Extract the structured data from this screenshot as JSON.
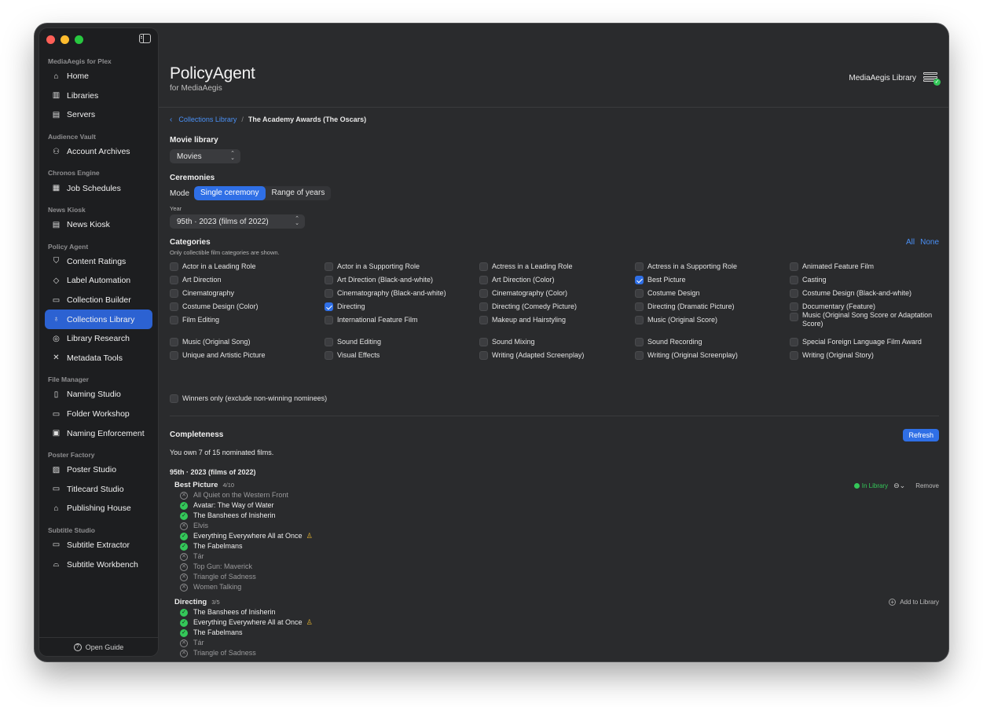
{
  "sidebar": {
    "sections": [
      {
        "title": "MediaAegis for Plex",
        "items": [
          {
            "label": "Home",
            "icon": "house-icon"
          },
          {
            "label": "Libraries",
            "icon": "books-icon"
          },
          {
            "label": "Servers",
            "icon": "server-icon"
          }
        ]
      },
      {
        "title": "Audience Vault",
        "items": [
          {
            "label": "Account Archives",
            "icon": "people-icon"
          }
        ]
      },
      {
        "title": "Chronos Engine",
        "items": [
          {
            "label": "Job Schedules",
            "icon": "calendar-clock-icon"
          }
        ]
      },
      {
        "title": "News Kiosk",
        "items": [
          {
            "label": "News Kiosk",
            "icon": "newspaper-icon"
          }
        ]
      },
      {
        "title": "Policy Agent",
        "items": [
          {
            "label": "Content Ratings",
            "icon": "shield-icon"
          },
          {
            "label": "Label Automation",
            "icon": "tag-icon"
          },
          {
            "label": "Collection Builder",
            "icon": "stack-icon"
          },
          {
            "label": "Collections Library",
            "icon": "ribbon-icon",
            "active": true
          },
          {
            "label": "Library Research",
            "icon": "magnifier-icon"
          },
          {
            "label": "Metadata Tools",
            "icon": "wrench-icon"
          }
        ]
      },
      {
        "title": "File Manager",
        "items": [
          {
            "label": "Naming Studio",
            "icon": "clipboard-icon"
          },
          {
            "label": "Folder Workshop",
            "icon": "folder-icon"
          },
          {
            "label": "Naming Enforcement",
            "icon": "checklist-icon"
          }
        ]
      },
      {
        "title": "Poster Factory",
        "items": [
          {
            "label": "Poster Studio",
            "icon": "photo-icon"
          },
          {
            "label": "Titlecard Studio",
            "icon": "display-icon"
          },
          {
            "label": "Publishing House",
            "icon": "building-icon"
          }
        ]
      },
      {
        "title": "Subtitle Studio",
        "items": [
          {
            "label": "Subtitle Extractor",
            "icon": "caption-icon"
          },
          {
            "label": "Subtitle Workbench",
            "icon": "workbench-icon"
          }
        ]
      }
    ],
    "footer_label": "Open Guide"
  },
  "header": {
    "title": "PolicyAgent",
    "subtitle": "for MediaAegis",
    "library_badge": "MediaAegis Library"
  },
  "breadcrumb": {
    "parent": "Collections Library",
    "separator": "/",
    "current": "The Academy Awards (The Oscars)"
  },
  "movie_library": {
    "label": "Movie library",
    "value": "Movies"
  },
  "ceremonies": {
    "label": "Ceremonies",
    "mode_label": "Mode",
    "modes": [
      "Single ceremony",
      "Range of years"
    ],
    "active_mode": "Single ceremony",
    "year_label": "Year",
    "year_value": "95th · 2023 (films of 2022)"
  },
  "categories": {
    "label": "Categories",
    "note": "Only collectible film categories are shown.",
    "all_label": "All",
    "none_label": "None",
    "items": [
      {
        "label": "Actor in a Leading Role",
        "checked": false
      },
      {
        "label": "Actor in a Supporting Role",
        "checked": false
      },
      {
        "label": "Actress in a Leading Role",
        "checked": false
      },
      {
        "label": "Actress in a Supporting Role",
        "checked": false
      },
      {
        "label": "Animated Feature Film",
        "checked": false
      },
      {
        "label": "Art Direction",
        "checked": false
      },
      {
        "label": "Art Direction (Black-and-white)",
        "checked": false
      },
      {
        "label": "Art Direction (Color)",
        "checked": false
      },
      {
        "label": "Best Picture",
        "checked": true
      },
      {
        "label": "Casting",
        "checked": false
      },
      {
        "label": "Cinematography",
        "checked": false
      },
      {
        "label": "Cinematography (Black-and-white)",
        "checked": false
      },
      {
        "label": "Cinematography (Color)",
        "checked": false
      },
      {
        "label": "Costume Design",
        "checked": false
      },
      {
        "label": "Costume Design (Black-and-white)",
        "checked": false
      },
      {
        "label": "Costume Design (Color)",
        "checked": false
      },
      {
        "label": "Directing",
        "checked": true
      },
      {
        "label": "Directing (Comedy Picture)",
        "checked": false
      },
      {
        "label": "Directing (Dramatic Picture)",
        "checked": false
      },
      {
        "label": "Documentary (Feature)",
        "checked": false
      },
      {
        "label": "Film Editing",
        "checked": false
      },
      {
        "label": "International Feature Film",
        "checked": false
      },
      {
        "label": "Makeup and Hairstyling",
        "checked": false
      },
      {
        "label": "Music (Original Score)",
        "checked": false
      },
      {
        "label": "Music (Original Song Score or Adaptation Score)",
        "checked": false
      },
      {
        "label": "Music (Original Song)",
        "checked": false
      },
      {
        "label": "Sound Editing",
        "checked": false
      },
      {
        "label": "Sound Mixing",
        "checked": false
      },
      {
        "label": "Sound Recording",
        "checked": false
      },
      {
        "label": "Special Foreign Language Film Award",
        "checked": false
      },
      {
        "label": "Unique and Artistic Picture",
        "checked": false
      },
      {
        "label": "Visual Effects",
        "checked": false
      },
      {
        "label": "Writing (Adapted Screenplay)",
        "checked": false
      },
      {
        "label": "Writing (Original Screenplay)",
        "checked": false
      },
      {
        "label": "Writing (Original Story)",
        "checked": false
      }
    ],
    "winners_only": {
      "label": "Winners only (exclude non-winning nominees)",
      "checked": false
    }
  },
  "completeness": {
    "label": "Completeness",
    "refresh_label": "Refresh",
    "summary": "You own 7 of 15 nominated films.",
    "ceremony_heading": "95th · 2023 (films of 2022)",
    "groups": [
      {
        "name": "Best Picture",
        "count": "4/10",
        "in_library_label": "In Library",
        "remove_label": "Remove",
        "films": [
          {
            "title": "All Quiet on the Western Front",
            "owned": false,
            "winner": false
          },
          {
            "title": "Avatar: The Way of Water",
            "owned": true,
            "winner": false
          },
          {
            "title": "The Banshees of Inisherin",
            "owned": true,
            "winner": false
          },
          {
            "title": "Elvis",
            "owned": false,
            "winner": false
          },
          {
            "title": "Everything Everywhere All at Once",
            "owned": true,
            "winner": true
          },
          {
            "title": "The Fabelmans",
            "owned": true,
            "winner": false
          },
          {
            "title": "Tár",
            "owned": false,
            "winner": false
          },
          {
            "title": "Top Gun: Maverick",
            "owned": false,
            "winner": false
          },
          {
            "title": "Triangle of Sadness",
            "owned": false,
            "winner": false
          },
          {
            "title": "Women Talking",
            "owned": false,
            "winner": false
          }
        ]
      },
      {
        "name": "Directing",
        "count": "3/5",
        "add_label": "Add to Library",
        "films": [
          {
            "title": "The Banshees of Inisherin",
            "owned": true,
            "winner": false
          },
          {
            "title": "Everything Everywhere All at Once",
            "owned": true,
            "winner": true
          },
          {
            "title": "The Fabelmans",
            "owned": true,
            "winner": false
          },
          {
            "title": "Tár",
            "owned": false,
            "winner": false
          },
          {
            "title": "Triangle of Sadness",
            "owned": false,
            "winner": false
          }
        ]
      }
    ]
  },
  "colors": {
    "accent": "#2f6fe6",
    "owned": "#34c759",
    "winner": "#e0b030"
  }
}
